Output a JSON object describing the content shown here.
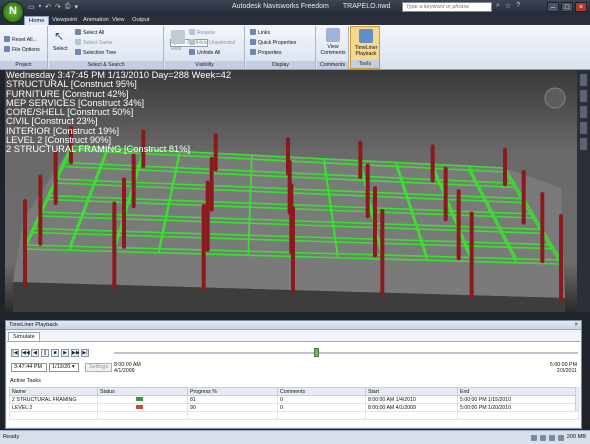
{
  "window": {
    "app_title": "Autodesk Navisworks Freedom",
    "file_name": "TRAPELO.nwd",
    "search_placeholder": "Type a keyword or phrase"
  },
  "tabs": [
    "Home",
    "Viewpoint",
    "Animation",
    "View",
    "Output"
  ],
  "ribbon": {
    "project": {
      "label": "Project",
      "reset": "Reset All...",
      "options": "File Options"
    },
    "select_search": {
      "label": "Select & Search",
      "select": "Select",
      "select_all": "Select All",
      "select_same": "Select Same",
      "selection_tree": "Selection Tree",
      "quick_find": "Quick Find"
    },
    "visibility": {
      "label": "Visibility",
      "hide": "Hide",
      "require": "Require",
      "hide_unselected": "Hide Unselected",
      "unhide_all": "Unhide All"
    },
    "display": {
      "label": "Display",
      "links": "Links",
      "quick_properties": "Quick Properties",
      "properties": "Properties"
    },
    "comments": {
      "label": "Comments",
      "view_comments": "View Comments"
    },
    "tools": {
      "label": "Tools",
      "timeliner": "TimeLiner Playback"
    }
  },
  "overlay": [
    "Wednesday 3:47:45 PM 1/13/2010 Day=288 Week=42",
    "STRUCTURAL [Construct 95%]",
    "FURNITURE [Construct 42%]",
    "MEP SERVICES [Construct 34%]",
    "CORE/SHELL [Construct 50%]",
    "CIVIL [Construct 23%]",
    "INTERIOR [Construct 19%]",
    "LEVEL 2 [Construct 90%]",
    "2 STRUCTURAL FRAMING [Construct 81%]"
  ],
  "timeliner": {
    "panel_title": "TimeLiner Playback",
    "tab": "Simulate",
    "time": "3:47:44 PM",
    "date": "1/13/20",
    "settings": "Settings",
    "start_stamp": [
      "8:00:00 AM",
      "4/1/2009"
    ],
    "end_stamp": [
      "5:00:00 PM",
      "2/3/2011"
    ],
    "progress_fraction": 0.43,
    "active_tasks_label": "Active Tasks",
    "columns": [
      "Name",
      "Status",
      "Progress %",
      "Comments",
      "Start",
      "End"
    ],
    "rows": [
      {
        "name": "2 STRUCTURAL FRAMING",
        "progress": "81",
        "comments": "0",
        "start": "8:00:00 AM 1/4/2010",
        "end": "5:00:00 PM 1/15/2010",
        "status_color": "#3a9a3a"
      },
      {
        "name": "LEVEL 2",
        "progress": "90",
        "comments": "0",
        "start": "8:00:00 AM 4/1/2009",
        "end": "5:00:00 PM 1/20/2010",
        "status_color": "#c64b3a"
      }
    ]
  },
  "status": {
    "left": "Ready",
    "right": "200 MB"
  },
  "colors": {
    "accent": "#6fbf3a",
    "steel_green": "#39e030",
    "column_red": "#8b1a1a"
  }
}
